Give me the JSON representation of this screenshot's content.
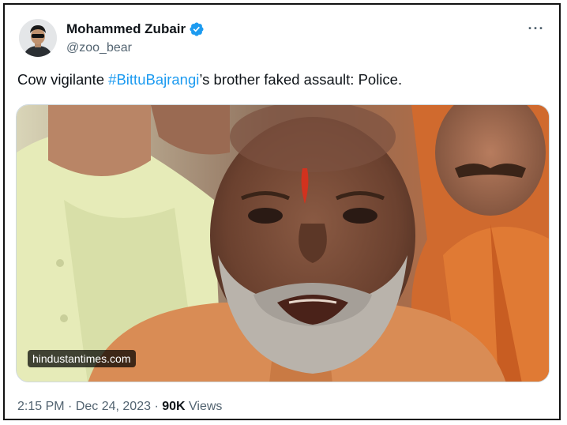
{
  "author": {
    "display_name": "Mohammed Zubair",
    "handle": "@zoo_bear",
    "verified_icon": "verified-badge-icon",
    "verified_color": "#1d9bf0"
  },
  "menu": {
    "more_icon": "more-horizontal-icon",
    "label": "···"
  },
  "tweet": {
    "text_before": "Cow vigilante ",
    "hashtag": "#BittuBajrangi",
    "text_after": "’s brother faked assault: Police."
  },
  "media": {
    "source_label": "hindustantimes.com"
  },
  "meta": {
    "time": "2:15 PM",
    "sep1": " · ",
    "date": "Dec 24, 2023",
    "sep2": " · ",
    "views_count": "90K",
    "views_label": " Views"
  },
  "colors": {
    "accent": "#1d9bf0",
    "text": "#0f1419",
    "secondary": "#536471"
  }
}
